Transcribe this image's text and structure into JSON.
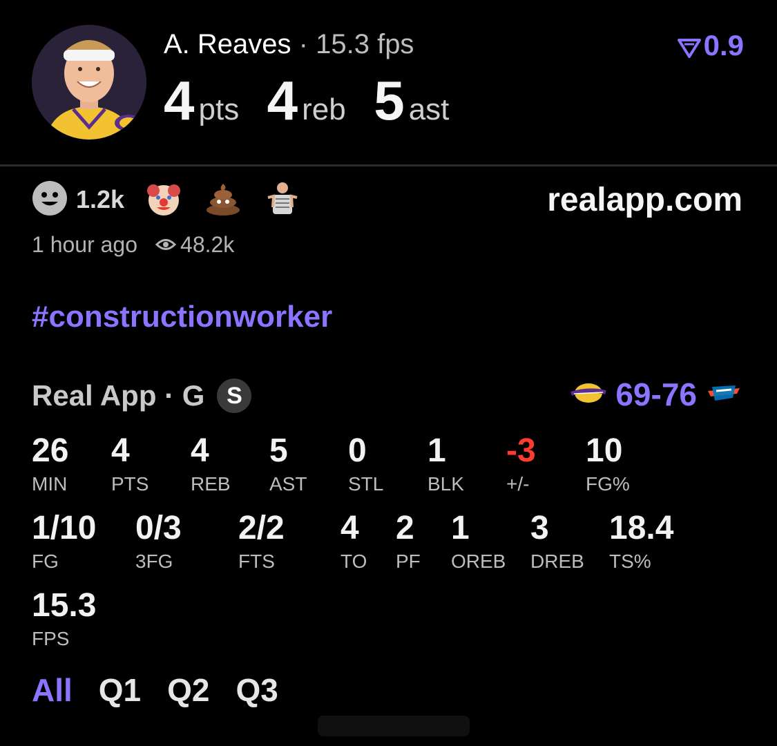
{
  "header": {
    "player_name": "A. Reaves",
    "separator": "·",
    "fps_text": "15.3 fps",
    "big_stats": [
      {
        "value": "4",
        "unit": "pts"
      },
      {
        "value": "4",
        "unit": "reb"
      },
      {
        "value": "5",
        "unit": "ast"
      }
    ],
    "rating_icon": "filter-v-icon",
    "rating": "0.9"
  },
  "reactions": {
    "count": "1.2k",
    "emojis": [
      "clown-emoji-icon",
      "poop-emoji-icon",
      "player-sticker-icon"
    ],
    "site": "realapp.com"
  },
  "meta": {
    "time": "1 hour ago",
    "views": "48.2k"
  },
  "hashtag": "#constructionworker",
  "source": {
    "label": "Real App · G",
    "badge": "S"
  },
  "game": {
    "score": "69-76",
    "home_team_logo": "lakers-logo-icon",
    "away_team_logo": "okc-logo-icon"
  },
  "stats_row1": [
    {
      "value": "26",
      "label": "MIN"
    },
    {
      "value": "4",
      "label": "PTS"
    },
    {
      "value": "4",
      "label": "REB"
    },
    {
      "value": "5",
      "label": "AST"
    },
    {
      "value": "0",
      "label": "STL"
    },
    {
      "value": "1",
      "label": "BLK"
    },
    {
      "value": "-3",
      "label": "+/-"
    },
    {
      "value": "10",
      "label": "FG%"
    }
  ],
  "stats_row2": [
    {
      "value": "1/10",
      "label": "FG"
    },
    {
      "value": "0/3",
      "label": "3FG"
    },
    {
      "value": "2/2",
      "label": "FTS"
    },
    {
      "value": "4",
      "label": "TO"
    },
    {
      "value": "2",
      "label": "PF"
    },
    {
      "value": "1",
      "label": "OREB"
    },
    {
      "value": "3",
      "label": "DREB"
    },
    {
      "value": "18.4",
      "label": "TS%"
    }
  ],
  "stats_row3": [
    {
      "value": "15.3",
      "label": "FPS"
    }
  ],
  "tabs": [
    "All",
    "Q1",
    "Q2",
    "Q3"
  ],
  "colors": {
    "accent": "#8b74ff",
    "negative": "#ff3b30",
    "background": "#000000"
  }
}
